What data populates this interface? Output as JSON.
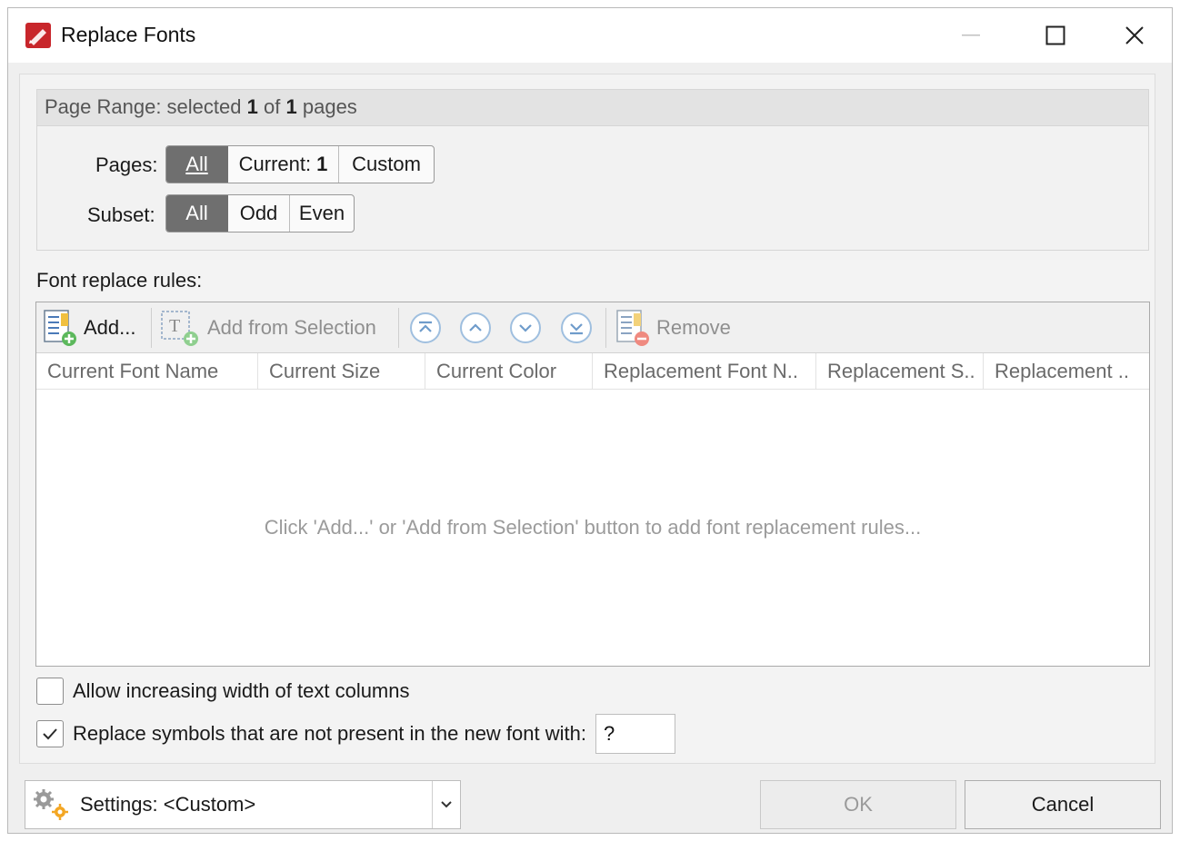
{
  "window": {
    "title": "Replace Fonts",
    "buttons": [
      "minimize",
      "maximize",
      "close"
    ]
  },
  "page_range": {
    "header_prefix": "Page Range: selected",
    "selected": "1",
    "of_text": "of",
    "total": "1",
    "suffix": "pages",
    "pages_label": "Pages:",
    "pages_options": {
      "all": "All",
      "current": "Current:",
      "current_value": "1",
      "custom": "Custom"
    },
    "pages_selected": "All",
    "subset_label": "Subset:",
    "subset_options": {
      "all": "All",
      "odd": "Odd",
      "even": "Even"
    },
    "subset_selected": "All"
  },
  "rules": {
    "label": "Font replace rules:",
    "toolbar": {
      "add": "Add...",
      "add_from_selection": "Add from Selection",
      "remove": "Remove",
      "nav_icons": [
        "move-to-top-icon",
        "move-up-icon",
        "move-down-icon",
        "move-to-bottom-icon"
      ]
    },
    "columns": [
      "Current Font Name",
      "Current Size",
      "Current Color",
      "Replacement Font N..",
      "Replacement S..",
      "Replacement .."
    ],
    "empty_message": "Click 'Add...' or 'Add from Selection' button to add font replacement rules..."
  },
  "options": {
    "allow_width": {
      "label": "Allow increasing width of text columns",
      "checked": false
    },
    "replace_symbols": {
      "label": "Replace symbols that are not present in the new font with:",
      "checked": true,
      "value": "?"
    }
  },
  "footer": {
    "settings_label": "Settings:",
    "settings_value": "<Custom>",
    "ok": "OK",
    "cancel": "Cancel"
  },
  "colors": {
    "segment_active": "#6f6f6f",
    "app_icon_red": "#c8262b",
    "nav_circle": "#7aa7d6",
    "add_green": "#5cb85c",
    "remove_red": "#e25b4f"
  }
}
